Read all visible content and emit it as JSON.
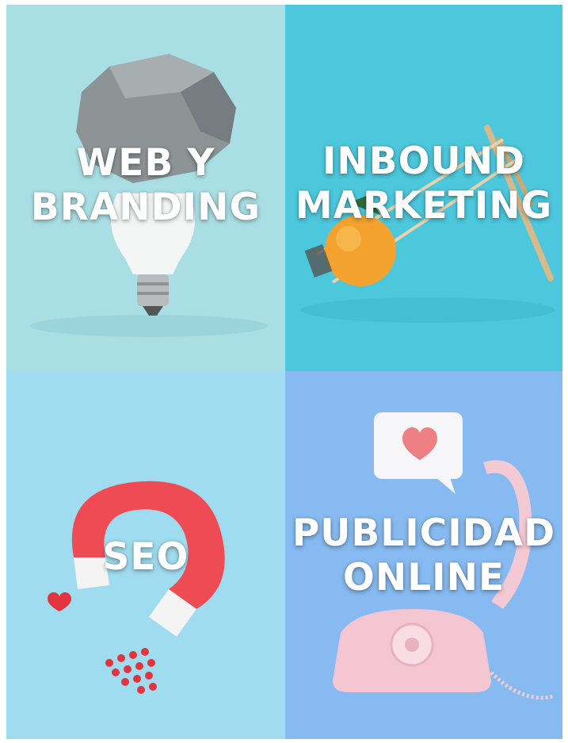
{
  "tiles": [
    {
      "line1": "WEB Y",
      "line2": "BRANDING",
      "color": "#a9dfe4"
    },
    {
      "line1": "INBOUND",
      "line2": "MARKETING",
      "color": "#4cc7dc"
    },
    {
      "line1": "SEO",
      "line2": "",
      "color": "#9fdcef"
    },
    {
      "line1": "PUBLICIDAD",
      "line2": "ONLINE",
      "color": "#86baf0"
    }
  ]
}
